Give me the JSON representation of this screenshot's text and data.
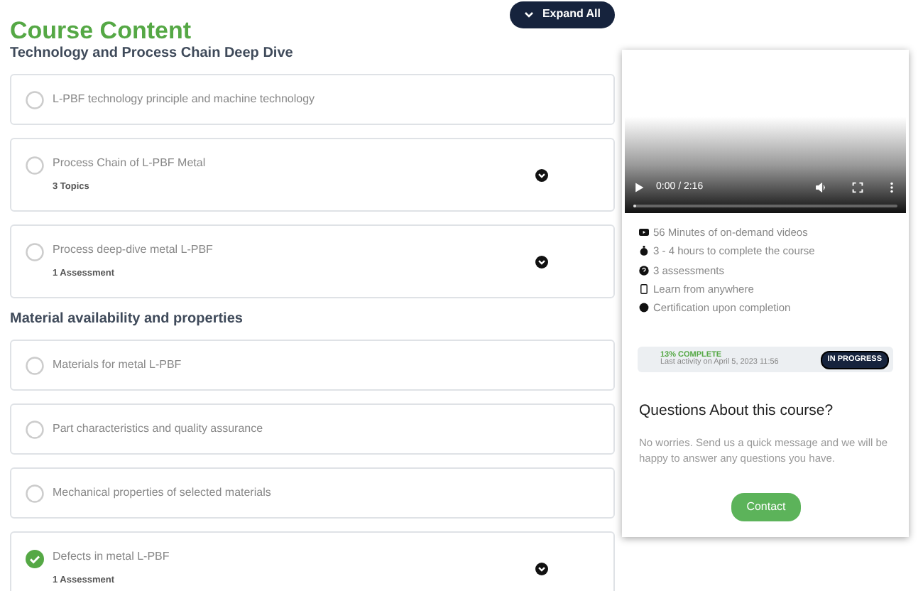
{
  "title": "Course Content",
  "expand_button": {
    "label": "Expand All"
  },
  "sections": [
    {
      "heading": "Technology and Process Chain Deep Dive",
      "items": [
        {
          "title": "L-PBF technology principle and machine technology",
          "completed": false,
          "expandable": false
        },
        {
          "title": "Process Chain of L-PBF Metal",
          "subtitle": "3 Topics",
          "completed": false,
          "expandable": true
        },
        {
          "title": "Process deep-dive metal L-PBF",
          "subtitle": "1 Assessment",
          "completed": false,
          "expandable": true
        }
      ]
    },
    {
      "heading": "Material availability and properties",
      "items": [
        {
          "title": "Materials for metal L-PBF",
          "completed": false,
          "expandable": false
        },
        {
          "title": "Part characteristics and quality assurance",
          "completed": false,
          "expandable": false
        },
        {
          "title": "Mechanical properties of selected materials",
          "completed": false,
          "expandable": false
        },
        {
          "title": "Defects in metal L-PBF",
          "subtitle": "1 Assessment",
          "completed": true,
          "expandable": true
        }
      ]
    }
  ],
  "video": {
    "time": "0:00 / 2:16",
    "level": 0.0
  },
  "features": [
    {
      "kind": "video",
      "text": "56 Minutes of on-demand videos"
    },
    {
      "kind": "timer",
      "text": "3 - 4 hours to complete the course"
    },
    {
      "kind": "question",
      "text": "3 assessments"
    },
    {
      "kind": "mobile",
      "text": "Learn from anywhere"
    },
    {
      "kind": "certificate",
      "text": "Certification upon completion"
    }
  ],
  "progress": {
    "complete": "13% COMPLETE",
    "last_activity": "Last activity on April 5, 2023 11:56",
    "status": "IN PROGRESS"
  },
  "questions": {
    "heading": "Questions About this course?",
    "text": "No worries. Send us a quick message and we will be happy to answer any questions you have.",
    "button": "Contact"
  }
}
